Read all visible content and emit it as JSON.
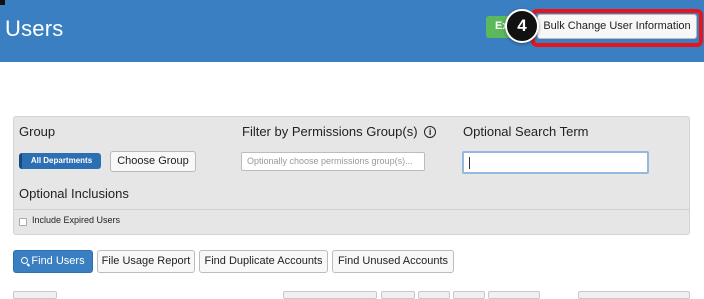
{
  "header": {
    "title": "Users",
    "green_button_label": "Ex",
    "step_number": "4",
    "bulk_change_label": "Bulk Change User Information"
  },
  "filters": {
    "group_label": "Group",
    "department_tag": "All Departments",
    "choose_group_label": "Choose Group",
    "permissions_label": "Filter by Permissions Group(s)",
    "info_glyph": "i",
    "permissions_placeholder": "Optionally choose permissions group(s)...",
    "search_label": "Optional Search Term",
    "search_value": "",
    "optional_inclusions_label": "Optional Inclusions",
    "include_expired_label": "Include Expired Users",
    "include_expired_checked": false
  },
  "actions": {
    "find_users": "Find Users",
    "file_usage_report": "File Usage Report",
    "find_duplicate_accounts": "Find Duplicate Accounts",
    "find_unused_accounts": "Find Unused Accounts"
  },
  "colors": {
    "header_blue": "#3a7fc1",
    "highlight_red": "#e8131b",
    "green": "#5cb85c"
  }
}
